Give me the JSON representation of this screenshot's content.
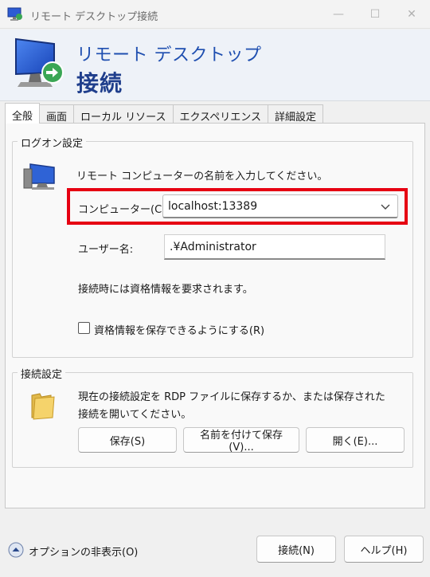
{
  "window": {
    "title": "リモート デスクトップ接続",
    "minimize_glyph": "—",
    "maximize_glyph": "☐",
    "close_glyph": "✕"
  },
  "banner": {
    "line1": "リモート デスクトップ",
    "line2": "接続"
  },
  "tabs": [
    {
      "label": "全般",
      "active": true
    },
    {
      "label": "画面",
      "active": false
    },
    {
      "label": "ローカル リソース",
      "active": false
    },
    {
      "label": "エクスペリエンス",
      "active": false
    },
    {
      "label": "詳細設定",
      "active": false
    }
  ],
  "logon": {
    "group_label": "ログオン設定",
    "prompt": "リモート コンピューターの名前を入力してください。",
    "computer_label": "コンピューター(C):",
    "computer_value": "localhost:13389",
    "user_label": "ユーザー名:",
    "user_value": ".¥Administrator",
    "credential_note": "接続時には資格情報を要求されます。",
    "save_credentials_label": "資格情報を保存できるようにする(R)",
    "save_credentials_checked": false,
    "highlight_color": "#e60012"
  },
  "connection": {
    "group_label": "接続設定",
    "description_line1": "現在の接続設定を RDP ファイルに保存するか、または保存された",
    "description_line2": "接続を開いてください。",
    "save_label": "保存(S)",
    "save_as_label": "名前を付けて保存(V)...",
    "open_label": "開く(E)..."
  },
  "footer": {
    "options_label": "オプションの非表示(O)",
    "connect_label": "接続(N)",
    "help_label": "ヘルプ(H)"
  },
  "icons": {
    "app": "remote-desktop-icon",
    "computer": "computer-icon",
    "folder": "folder-icon",
    "options": "chevron-up-circle-icon",
    "dropdown": "chevron-down-icon"
  }
}
